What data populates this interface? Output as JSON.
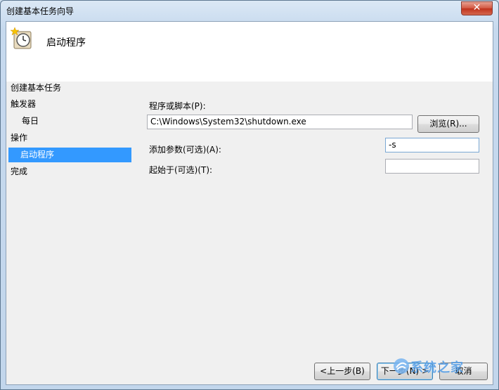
{
  "window": {
    "title": "创建基本任务向导",
    "close_glyph": "✕"
  },
  "header": {
    "title": "启动程序",
    "icon": "task-scheduler-clock-icon"
  },
  "nav": {
    "items": [
      {
        "label": "创建基本任务",
        "level": 0,
        "selected": false
      },
      {
        "label": "触发器",
        "level": 0,
        "selected": false
      },
      {
        "label": "每日",
        "level": 1,
        "selected": false
      },
      {
        "label": "操作",
        "level": 0,
        "selected": false
      },
      {
        "label": "启动程序",
        "level": 1,
        "selected": true
      },
      {
        "label": "完成",
        "level": 0,
        "selected": false
      }
    ]
  },
  "form": {
    "program_label": "程序或脚本(P):",
    "program_value": "C:\\Windows\\System32\\shutdown.exe",
    "browse_label": "浏览(R)...",
    "args_label": "添加参数(可选)(A):",
    "args_value": "-s",
    "startin_label": "起始于(可选)(T):",
    "startin_value": ""
  },
  "footer": {
    "back_label": "<上一步(B)",
    "next_label": "下一步(N) >",
    "cancel_label": "取消"
  },
  "watermark": {
    "text": "系统之家"
  },
  "colors": {
    "selection": "#3399ff",
    "client_bg": "#f0f0f0",
    "header_bg": "#ffffff"
  }
}
